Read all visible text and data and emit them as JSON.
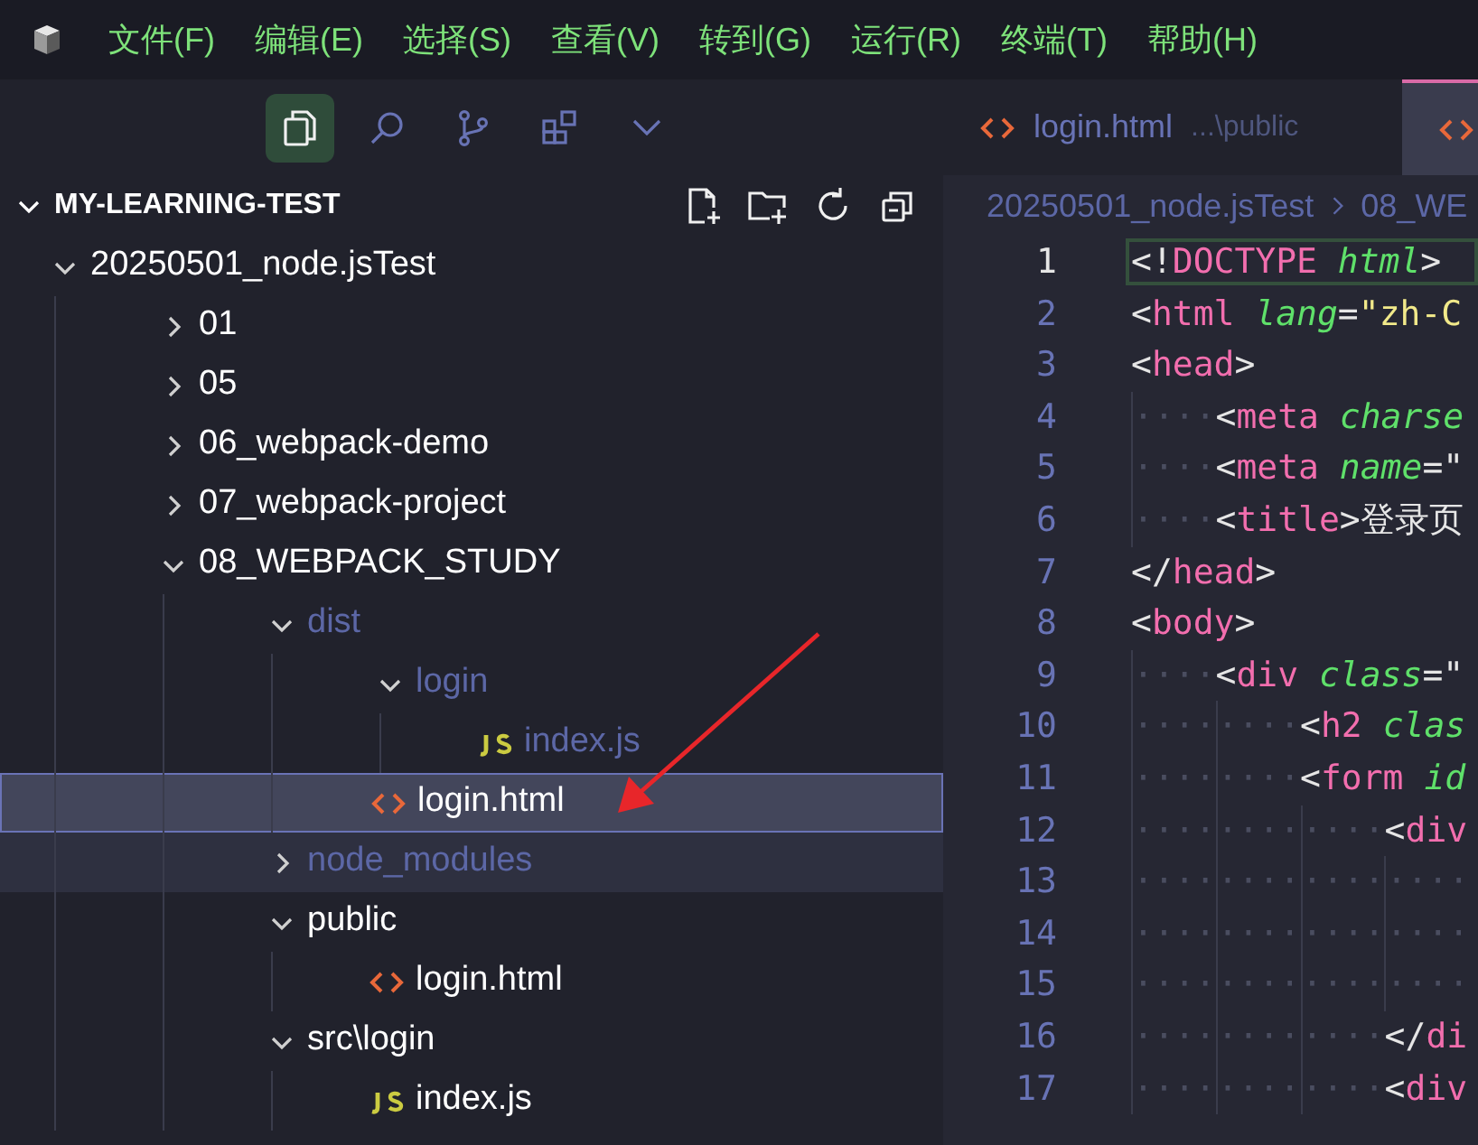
{
  "menu": {
    "items": [
      "文件(F)",
      "编辑(E)",
      "选择(S)",
      "查看(V)",
      "转到(G)",
      "运行(R)",
      "终端(T)",
      "帮助(H)"
    ]
  },
  "activity_bar": [
    {
      "kind": "explorer",
      "selected": true
    },
    {
      "kind": "search",
      "selected": false
    },
    {
      "kind": "source-control",
      "selected": false
    },
    {
      "kind": "extensions",
      "selected": false
    },
    {
      "kind": "more",
      "selected": false
    }
  ],
  "tabs": [
    {
      "kind": "html",
      "label": "login.html",
      "description": "...\\public",
      "selected": false
    },
    {
      "kind": "html",
      "selected": true
    }
  ],
  "explorer": {
    "workspace": {
      "label": "MY-LEARNING-TEST",
      "expanded": true
    },
    "actions": [
      {
        "kind": "new-file"
      },
      {
        "kind": "new-folder"
      },
      {
        "kind": "refresh"
      },
      {
        "kind": "collapse"
      }
    ],
    "tree": [
      {
        "kind": "folder",
        "label": "20250501_node.jsTest",
        "expanded": true,
        "ignored": false,
        "selected": false,
        "hovered": false,
        "children": [
          {
            "kind": "folder",
            "label": "01",
            "expanded": false,
            "ignored": false,
            "selected": false,
            "hovered": false
          },
          {
            "kind": "folder",
            "label": "05",
            "expanded": false,
            "ignored": false,
            "selected": false,
            "hovered": false
          },
          {
            "kind": "folder",
            "label": "06_webpack-demo",
            "expanded": false,
            "ignored": false,
            "selected": false,
            "hovered": false
          },
          {
            "kind": "folder",
            "label": "07_webpack-project",
            "expanded": false,
            "ignored": false,
            "selected": false,
            "hovered": false
          },
          {
            "kind": "folder",
            "label": "08_WEBPACK_STUDY",
            "expanded": true,
            "ignored": false,
            "selected": false,
            "hovered": false,
            "children": [
              {
                "kind": "folder",
                "label": "dist",
                "expanded": true,
                "ignored": true,
                "selected": false,
                "hovered": false,
                "children": [
                  {
                    "kind": "folder",
                    "label": "login",
                    "expanded": true,
                    "ignored": true,
                    "selected": false,
                    "hovered": false,
                    "children": [
                      {
                        "kind": "js",
                        "label": "index.js",
                        "ignored": true,
                        "selected": false,
                        "hovered": false
                      }
                    ]
                  },
                  {
                    "kind": "html",
                    "label": "login.html",
                    "ignored": false,
                    "selected": true,
                    "hovered": false
                  }
                ]
              },
              {
                "kind": "folder",
                "label": "node_modules",
                "expanded": false,
                "ignored": true,
                "selected": false,
                "hovered": true
              },
              {
                "kind": "folder",
                "label": "public",
                "expanded": true,
                "ignored": false,
                "selected": false,
                "hovered": false,
                "children": [
                  {
                    "kind": "html",
                    "label": "login.html",
                    "ignored": false,
                    "selected": false,
                    "hovered": false
                  }
                ]
              },
              {
                "kind": "folder",
                "label": "src\\login",
                "expanded": true,
                "ignored": false,
                "selected": false,
                "hovered": false,
                "children": [
                  {
                    "kind": "js",
                    "label": "index.js",
                    "ignored": false,
                    "selected": false,
                    "hovered": false
                  }
                ]
              }
            ]
          }
        ]
      }
    ]
  },
  "editor": {
    "breadcrumb": [
      "20250501_node.jsTest",
      "08_WE"
    ],
    "lines": [
      {
        "number": "1",
        "current": true,
        "tokens": [
          {
            "kind": "punct",
            "text": "<!"
          },
          {
            "kind": "tag",
            "text": "DOCTYPE"
          },
          {
            "kind": "attr",
            "text": " html"
          },
          {
            "kind": "punct",
            "text": ">"
          }
        ]
      },
      {
        "number": "2",
        "current": false,
        "tokens": [
          {
            "kind": "punct",
            "text": "<"
          },
          {
            "kind": "tag",
            "text": "html"
          },
          {
            "kind": "attr",
            "text": " lang"
          },
          {
            "kind": "punct",
            "text": "="
          },
          {
            "kind": "string",
            "text": "\"zh-C"
          }
        ]
      },
      {
        "number": "3",
        "current": false,
        "tokens": [
          {
            "kind": "punct",
            "text": "<"
          },
          {
            "kind": "tag",
            "text": "head"
          },
          {
            "kind": "punct",
            "text": ">"
          }
        ]
      },
      {
        "number": "4",
        "current": false,
        "tokens": [
          {
            "kind": "ws",
            "text": "····"
          },
          {
            "kind": "punct",
            "text": "<"
          },
          {
            "kind": "tag",
            "text": "meta"
          },
          {
            "kind": "attr",
            "text": " charse"
          }
        ]
      },
      {
        "number": "5",
        "current": false,
        "tokens": [
          {
            "kind": "ws",
            "text": "····"
          },
          {
            "kind": "punct",
            "text": "<"
          },
          {
            "kind": "tag",
            "text": "meta"
          },
          {
            "kind": "attr",
            "text": " name"
          },
          {
            "kind": "punct",
            "text": "=\""
          }
        ]
      },
      {
        "number": "6",
        "current": false,
        "tokens": [
          {
            "kind": "ws",
            "text": "····"
          },
          {
            "kind": "punct",
            "text": "<"
          },
          {
            "kind": "tag",
            "text": "title"
          },
          {
            "kind": "punct",
            "text": ">登录页"
          }
        ]
      },
      {
        "number": "7",
        "current": false,
        "tokens": [
          {
            "kind": "punct",
            "text": "</"
          },
          {
            "kind": "tag",
            "text": "head"
          },
          {
            "kind": "punct",
            "text": ">"
          }
        ]
      },
      {
        "number": "8",
        "current": false,
        "tokens": [
          {
            "kind": "punct",
            "text": "<"
          },
          {
            "kind": "tag",
            "text": "body"
          },
          {
            "kind": "punct",
            "text": ">"
          }
        ]
      },
      {
        "number": "9",
        "current": false,
        "tokens": [
          {
            "kind": "ws",
            "text": "····"
          },
          {
            "kind": "punct",
            "text": "<"
          },
          {
            "kind": "tag",
            "text": "div"
          },
          {
            "kind": "attr",
            "text": " class"
          },
          {
            "kind": "punct",
            "text": "=\""
          }
        ]
      },
      {
        "number": "10",
        "current": false,
        "tokens": [
          {
            "kind": "ws",
            "text": "········"
          },
          {
            "kind": "punct",
            "text": "<"
          },
          {
            "kind": "tag",
            "text": "h2"
          },
          {
            "kind": "attr",
            "text": " clas"
          }
        ]
      },
      {
        "number": "11",
        "current": false,
        "tokens": [
          {
            "kind": "ws",
            "text": "········"
          },
          {
            "kind": "punct",
            "text": "<"
          },
          {
            "kind": "tag",
            "text": "form"
          },
          {
            "kind": "attr",
            "text": " id"
          }
        ]
      },
      {
        "number": "12",
        "current": false,
        "tokens": [
          {
            "kind": "ws",
            "text": "············"
          },
          {
            "kind": "punct",
            "text": "<"
          },
          {
            "kind": "tag",
            "text": "div"
          }
        ]
      },
      {
        "number": "13",
        "current": false,
        "tokens": [
          {
            "kind": "ws",
            "text": "················"
          }
        ]
      },
      {
        "number": "14",
        "current": false,
        "tokens": [
          {
            "kind": "ws",
            "text": "················"
          }
        ]
      },
      {
        "number": "15",
        "current": false,
        "tokens": [
          {
            "kind": "ws",
            "text": "················"
          }
        ]
      },
      {
        "number": "16",
        "current": false,
        "tokens": [
          {
            "kind": "ws",
            "text": "············"
          },
          {
            "kind": "punct",
            "text": "</"
          },
          {
            "kind": "tag",
            "text": "di"
          }
        ]
      },
      {
        "number": "17",
        "current": false,
        "tokens": [
          {
            "kind": "ws",
            "text": "············"
          },
          {
            "kind": "punct",
            "text": "<"
          },
          {
            "kind": "tag",
            "text": "div"
          }
        ]
      }
    ]
  }
}
